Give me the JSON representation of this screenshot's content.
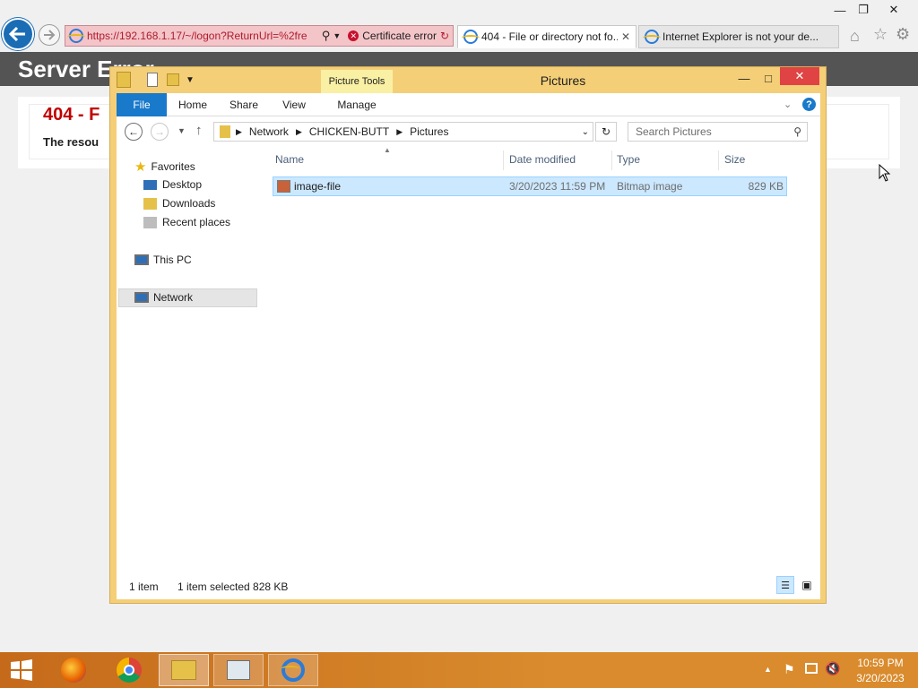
{
  "browser": {
    "address_url": "https://192.168.1.17/~/logon?ReturnUrl=%2fre",
    "certificate_error": "Certificate error",
    "tabs": [
      {
        "label": "404 - File or directory not fo..."
      },
      {
        "label": "Internet Explorer is not your de..."
      }
    ]
  },
  "page": {
    "header": "Server Error",
    "error_title": "404 - F",
    "error_text": "The resou"
  },
  "explorer": {
    "title": "Pictures",
    "picture_tools": "Picture Tools",
    "ribbon_tabs": [
      "File",
      "Home",
      "Share",
      "View",
      "Manage"
    ],
    "breadcrumb": [
      "Network",
      "CHICKEN-BUTT",
      "Pictures"
    ],
    "search_placeholder": "Search Pictures",
    "sidebar": {
      "favorites": "Favorites",
      "items": [
        "Desktop",
        "Downloads",
        "Recent places"
      ],
      "this_pc": "This PC",
      "network": "Network"
    },
    "columns": [
      "Name",
      "Date modified",
      "Type",
      "Size"
    ],
    "files": [
      {
        "name": "image-file",
        "date": "3/20/2023 11:59 PM",
        "type": "Bitmap image",
        "size": "829 KB"
      }
    ],
    "status": {
      "count": "1 item",
      "selected": "1 item selected  828 KB"
    }
  },
  "taskbar": {
    "time": "10:59 PM",
    "date": "3/20/2023"
  },
  "colors": {
    "accent": "#1a6cb5",
    "explorer_frame": "#f4cf78",
    "close": "#e04343",
    "selection": "#cce8ff"
  }
}
